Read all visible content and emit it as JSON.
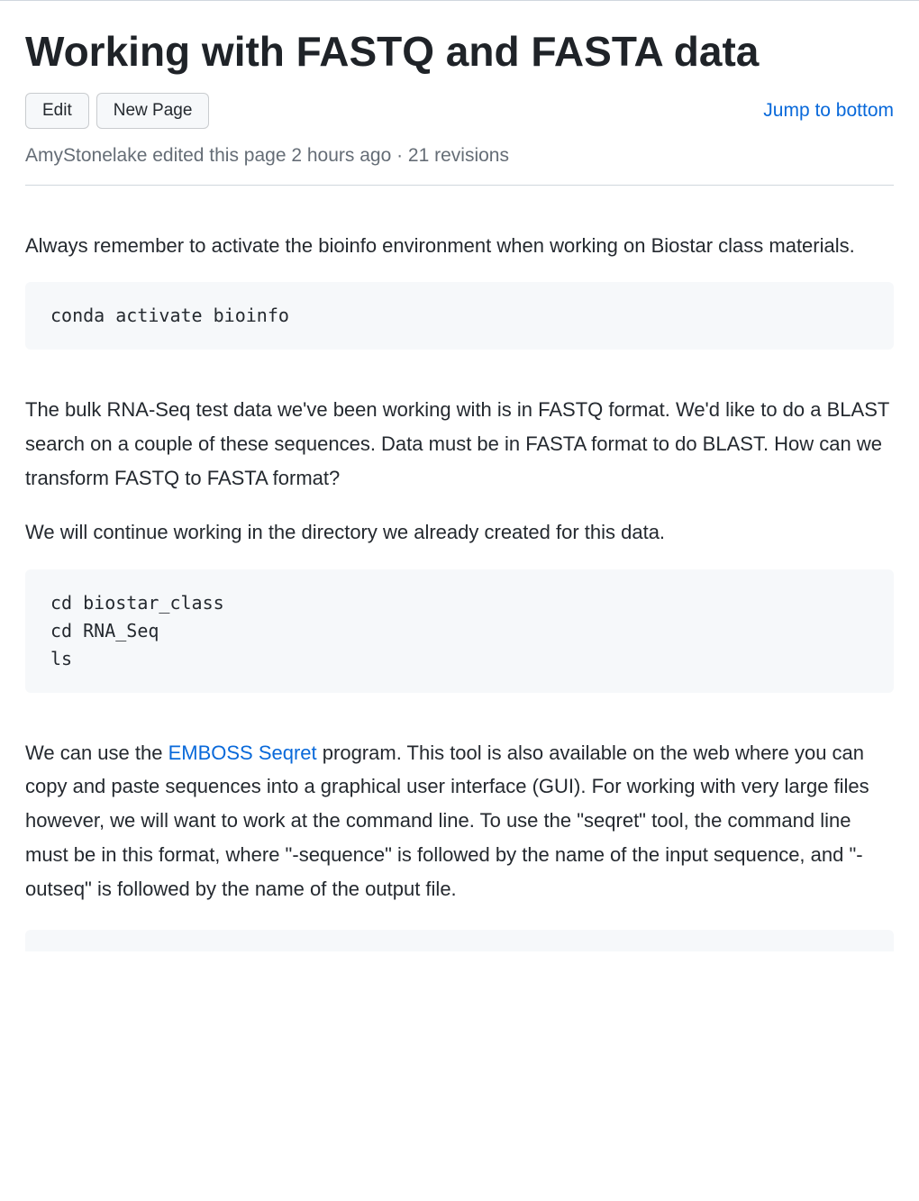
{
  "title": "Working with FASTQ and FASTA data",
  "buttons": {
    "edit": "Edit",
    "new_page": "New Page"
  },
  "jump_link": "Jump to bottom",
  "meta": "AmyStonelake edited this page 2 hours ago · 21 revisions",
  "para1": "Always remember to activate the bioinfo environment when working on Biostar class materials.",
  "code1": "conda activate bioinfo",
  "para2": "The bulk RNA-Seq test data we've been working with is in FASTQ format. We'd like to do a BLAST search on a couple of these sequences. Data must be in FASTA format to do BLAST. How can we transform FASTQ to FASTA format?",
  "para3": "We will continue working in the directory we already created for this data.",
  "code2": "cd biostar_class\ncd RNA_Seq\nls",
  "para4_pre": "We can use the ",
  "para4_link": "EMBOSS Seqret",
  "para4_post": " program. This tool is also available on the web where you can copy and paste sequences into a graphical user interface (GUI). For working with very large files however, we will want to work at the command line. To use the \"seqret\" tool, the command line must be in this format, where \"-sequence\" is followed by the name of the input sequence, and \"-outseq\" is followed by the name of the output file."
}
